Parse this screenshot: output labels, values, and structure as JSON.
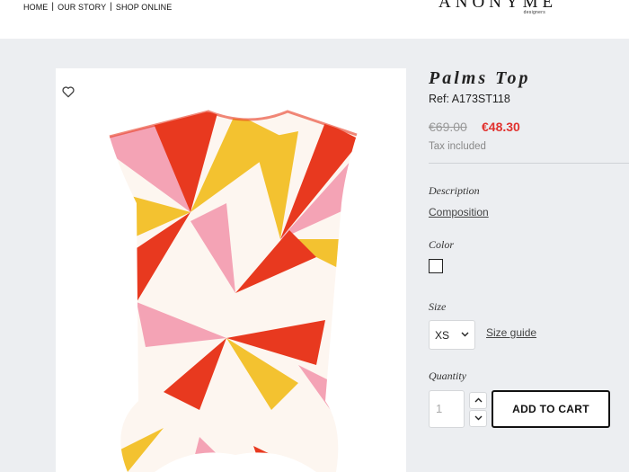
{
  "header": {
    "nav": [
      {
        "label": "HOME"
      },
      {
        "label": "OUR STORY"
      },
      {
        "label": "SHOP ONLINE"
      }
    ],
    "nav_separator": "|",
    "logo": {
      "word": "ANONYME",
      "sub": "designers"
    }
  },
  "product": {
    "image_icon": "blouse-icon",
    "wishlist_icon": "heart-outline-icon",
    "title": "Palms Top",
    "ref": "Ref: A173ST118",
    "old_price": "€69.00",
    "price": "€48.30",
    "tax": "Tax included",
    "description_label": "Description",
    "composition_link": "Composition",
    "color_label": "Color",
    "color_swatch": "#ffffff",
    "size_label": "Size",
    "size_selected": "XS",
    "size_guide": "Size guide",
    "quantity_label": "Quantity",
    "quantity_value": "1",
    "add_to_cart": "ADD TO CART"
  },
  "colors": {
    "page_bg": "#eceef1",
    "price_red": "#e1322f",
    "print_red": "#e8391f",
    "print_yellow": "#f3c230",
    "print_pink": "#f4a3b5"
  }
}
